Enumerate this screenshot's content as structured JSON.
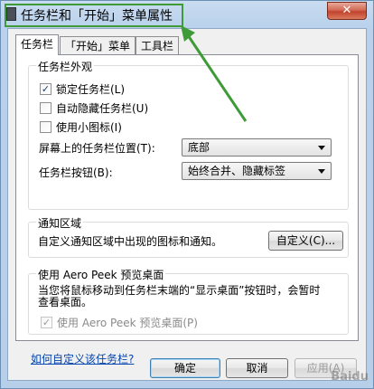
{
  "window": {
    "title": "任务栏和「开始」菜单属性",
    "close_glyph": "✕"
  },
  "tabs": [
    {
      "label": "任务栏",
      "active": true
    },
    {
      "label": "「开始」菜单",
      "active": false
    },
    {
      "label": "工具栏",
      "active": false
    }
  ],
  "appearance": {
    "heading": "任务栏外观",
    "lock": {
      "label": "锁定任务栏(L)",
      "checked": true
    },
    "autohide": {
      "label": "自动隐藏任务栏(U)",
      "checked": false
    },
    "small_icons": {
      "label": "使用小图标(I)",
      "checked": false
    },
    "location": {
      "label": "屏幕上的任务栏位置(T):",
      "value": "底部"
    },
    "buttons": {
      "label": "任务栏按钮(B):",
      "value": "始终合并、隐藏标签"
    }
  },
  "notification": {
    "heading": "通知区域",
    "description": "自定义通知区域中出现的图标和通知。",
    "customize_button": "自定义(C)..."
  },
  "aero": {
    "heading": "使用 Aero Peek 预览桌面",
    "description_line1": "当您将鼠标移动到任务栏末端的“显示桌面”按钮时，会暂时",
    "description_line2": "查看桌面。",
    "checkbox": {
      "label": "使用 Aero Peek 预览桌面(P)",
      "checked": true,
      "disabled": true
    }
  },
  "help_link": "如何自定义该任务栏?",
  "footer": {
    "ok": "确定",
    "cancel": "取消",
    "apply": "应用(A)"
  },
  "colors": {
    "highlight": "#3f9a38",
    "arrow": "#3f9a38"
  },
  "watermark": "Baidu"
}
